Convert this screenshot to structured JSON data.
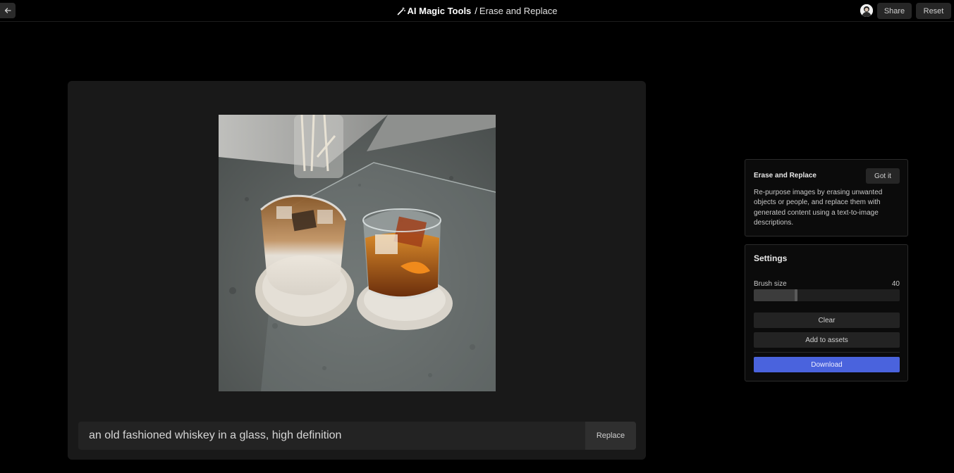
{
  "header": {
    "breadcrumb_root": "AI Magic Tools",
    "breadcrumb_separator": "/",
    "breadcrumb_current": "Erase and Replace",
    "share_label": "Share",
    "reset_label": "Reset"
  },
  "canvas": {
    "prompt_value": "an old fashioned whiskey in a glass, high definition",
    "replace_label": "Replace"
  },
  "info_card": {
    "title": "Erase and Replace",
    "got_it_label": "Got it",
    "description": "Re-purpose images by erasing unwanted objects or people, and replace them with generated content using a text-to-image descriptions."
  },
  "settings": {
    "title": "Settings",
    "brush_label": "Brush size",
    "brush_value": "40",
    "brush_fraction": 0.29,
    "clear_label": "Clear",
    "add_assets_label": "Add to assets",
    "download_label": "Download"
  },
  "colors": {
    "accent": "#4a63dd",
    "panel": "#191919",
    "background": "#000000"
  },
  "icons": {
    "back": "arrow-left-icon",
    "breadcrumb": "magic-wand-icon"
  }
}
